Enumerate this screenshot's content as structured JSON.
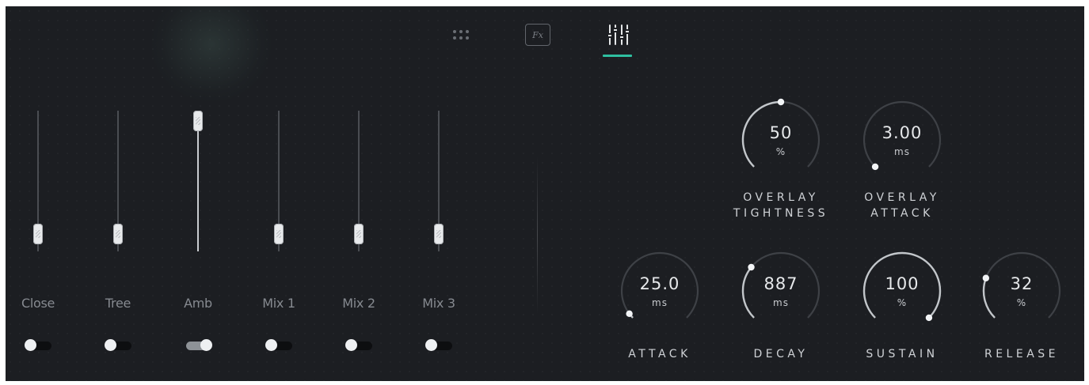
{
  "tabs": [
    {
      "name": "grid",
      "icon": "grid-dots-icon"
    },
    {
      "name": "fx",
      "label": "Fx",
      "icon": "fx-icon"
    },
    {
      "name": "mixer",
      "icon": "mixer-sliders-icon",
      "active": true
    }
  ],
  "accent_color": "#2fbfa0",
  "channels": [
    {
      "label": "Close",
      "level": 0.06,
      "enabled": false
    },
    {
      "label": "Tree",
      "level": 0.06,
      "enabled": false
    },
    {
      "label": "Amb",
      "level": 1.0,
      "enabled": true
    },
    {
      "label": "Mix 1",
      "level": 0.06,
      "enabled": false
    },
    {
      "label": "Mix 2",
      "level": 0.06,
      "enabled": false
    },
    {
      "label": "Mix 3",
      "level": 0.06,
      "enabled": false
    }
  ],
  "knobs": [
    {
      "id": "overlay-tightness",
      "value": "50",
      "unit": "%",
      "label_lines": [
        "OVERLAY",
        "TIGHTNESS"
      ],
      "position": 0.5
    },
    {
      "id": "overlay-attack",
      "value": "3.00",
      "unit": "ms",
      "label_lines": [
        "OVERLAY",
        "ATTACK"
      ],
      "position": 0.0
    },
    {
      "id": "attack",
      "value": "25.0",
      "unit": "ms",
      "label_lines": [
        "ATTACK"
      ],
      "position": 0.03
    },
    {
      "id": "decay",
      "value": "887",
      "unit": "ms",
      "label_lines": [
        "DECAY"
      ],
      "position": 0.31
    },
    {
      "id": "sustain",
      "value": "100",
      "unit": "%",
      "label_lines": [
        "SUSTAIN"
      ],
      "position": 1.0
    },
    {
      "id": "release",
      "value": "32",
      "unit": "%",
      "label_lines": [
        "RELEASE"
      ],
      "position": 0.24
    }
  ]
}
